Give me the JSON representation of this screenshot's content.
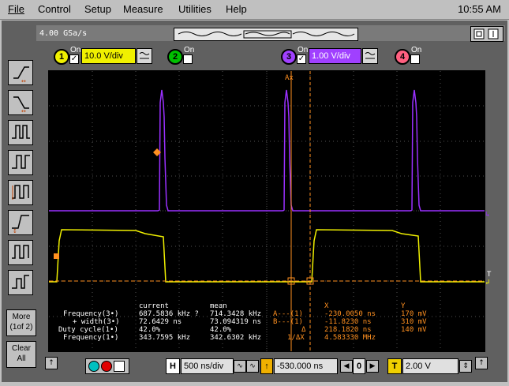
{
  "menu": [
    "File",
    "Control",
    "Setup",
    "Measure",
    "Utilities",
    "Help"
  ],
  "clock": "10:55 AM",
  "sample_rate": "4.00 GSa/s",
  "channels": [
    {
      "num": "1",
      "on_label": "On",
      "checked": true,
      "scale": "10.0 V/div",
      "color": "#f0f000"
    },
    {
      "num": "2",
      "on_label": "On",
      "checked": false,
      "color": "#00c000"
    },
    {
      "num": "3",
      "on_label": "On",
      "checked": true,
      "scale": "1.00 V/div",
      "color": "#a040ff"
    },
    {
      "num": "4",
      "on_label": "On",
      "checked": false,
      "color": "#ff6080"
    }
  ],
  "side_buttons": {
    "more_line1": "More",
    "more_line2": "(1of 2)",
    "clear_line1": "Clear",
    "clear_line2": "All"
  },
  "markers": {
    "ax": "Ax",
    "trig_label": "T"
  },
  "measurements": {
    "header_current": "current",
    "header_mean": "mean",
    "rows": [
      {
        "label": "Frequency(3•)",
        "current": "687.5836 kHz ?",
        "mean": "714.3428 kHz"
      },
      {
        "label": "+ width(3•)",
        "current": "72.6429 ns",
        "mean": "73.094319 ns"
      },
      {
        "label": "Duty cycle(1•)",
        "current": "42.0%",
        "mean": "42.0%"
      },
      {
        "label": "Frequency(1•)",
        "current": "343.7595 kHz",
        "mean": "342.6302 kHz"
      }
    ],
    "marker_header_x": "X",
    "marker_header_y": "Y",
    "marker_rows": [
      {
        "label": "A---(1)",
        "x": "-230.0050 ns",
        "y": "170 mV"
      },
      {
        "label": "B---(1)",
        "x": "-11.8230 ns",
        "y": "310 mV"
      },
      {
        "label": "Δ",
        "x": "218.1820 ns",
        "y": "140 mV"
      },
      {
        "label": "1/ΔX",
        "x": "4.583330 MHz",
        "y": ""
      }
    ]
  },
  "bottom": {
    "h_label": "H",
    "timebase": "500 ns/div",
    "delay": "-530.000 ns",
    "zero": "0",
    "t_label": "T",
    "trig_level": "2.00 V"
  },
  "colors": {
    "ch1": "#f0f000",
    "ch3": "#9a30ff",
    "marker": "#ff9020",
    "grid": "#505050"
  }
}
